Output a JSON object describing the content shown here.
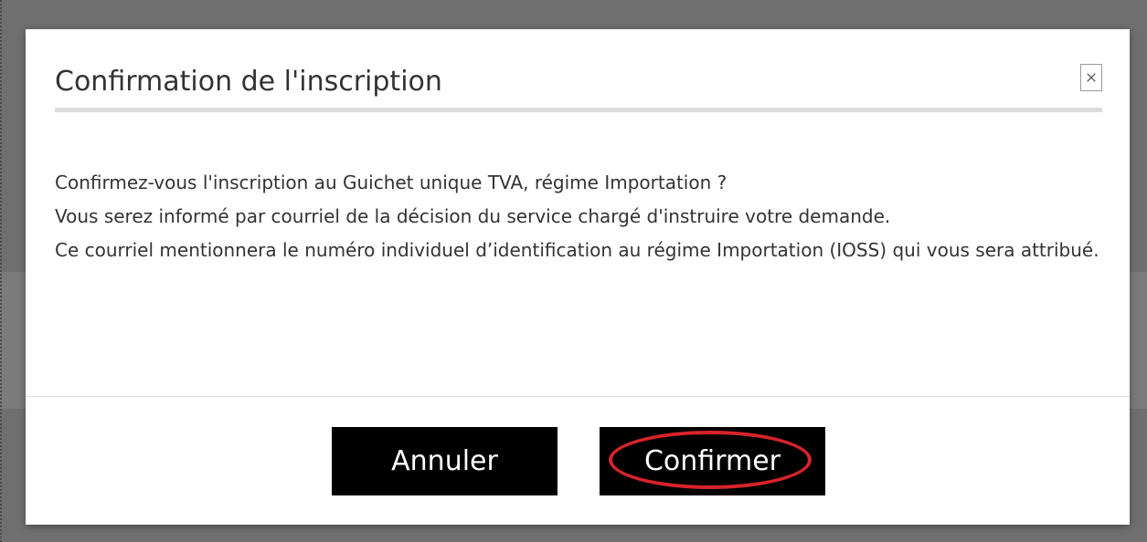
{
  "dialog": {
    "title": "Confirmation de l'inscription",
    "close_symbol": "×",
    "body_lines": [
      "Confirmez-vous l'inscription au Guichet unique TVA, régime Importation ?",
      "Vous serez informé par courriel de la décision du service chargé d'instruire votre demande.",
      "Ce courriel mentionnera le numéro individuel d’identification au régime Importation (IOSS) qui vous sera attribué."
    ],
    "buttons": {
      "cancel_label": "Annuler",
      "confirm_label": "Confirmer"
    },
    "highlight_color": "#d6232a"
  },
  "icons": {
    "close": "close-icon"
  }
}
